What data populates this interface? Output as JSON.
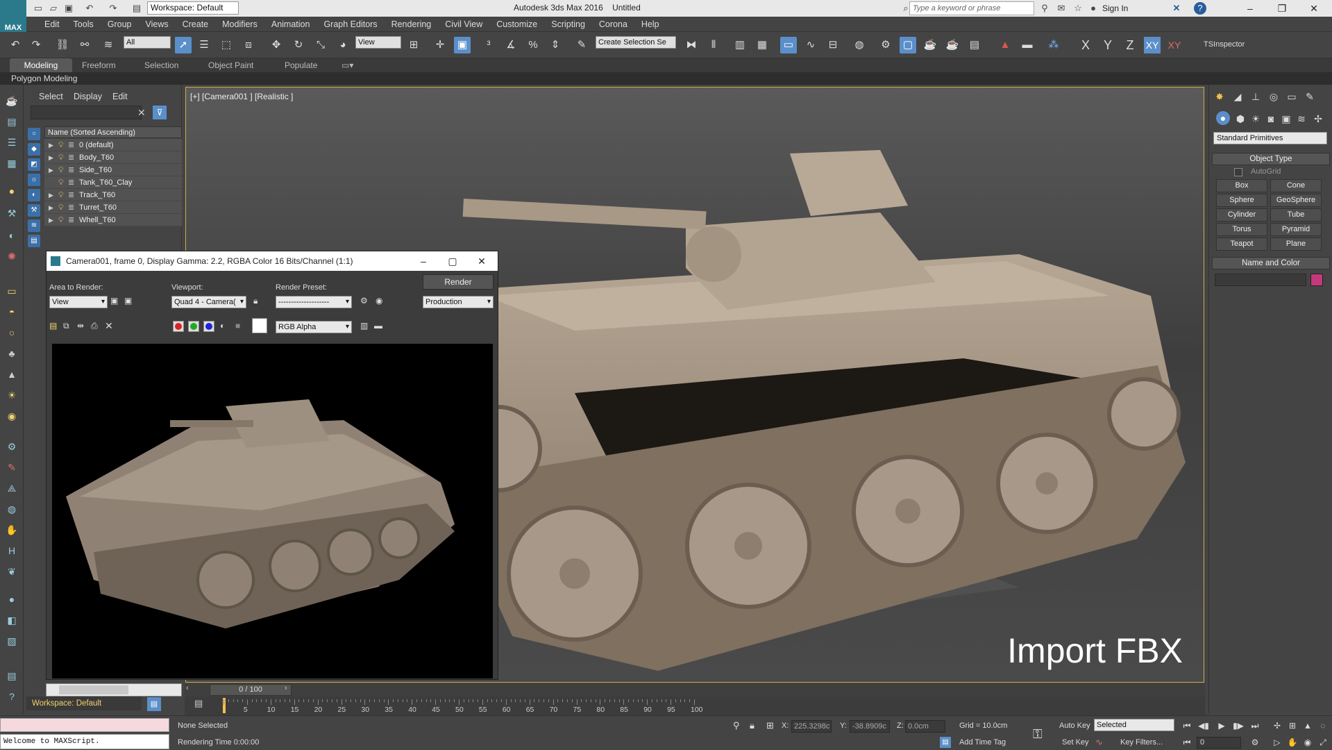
{
  "app": {
    "logo": "MAX",
    "workspace": "Workspace: Default",
    "title": "Autodesk 3ds Max 2016",
    "file": "Untitled",
    "search_placeholder": "Type a keyword or phrase",
    "sign_in": "Sign In"
  },
  "menu": [
    "Edit",
    "Tools",
    "Group",
    "Views",
    "Create",
    "Modifiers",
    "Animation",
    "Graph Editors",
    "Rendering",
    "Civil View",
    "Customize",
    "Scripting",
    "Corona",
    "Help"
  ],
  "toolbar": {
    "filter": "All",
    "ref_coord": "View",
    "named_sel": "Create Selection Se",
    "axes": [
      "X",
      "Y",
      "Z",
      "XY",
      "XY"
    ],
    "inspector": "TSInspector"
  },
  "ribbon": {
    "tabs": [
      "Modeling",
      "Freeform",
      "Selection",
      "Object Paint",
      "Populate"
    ],
    "active": "Modeling",
    "sub": "Polygon Modeling"
  },
  "explorer": {
    "menu": [
      "Select",
      "Display",
      "Edit"
    ],
    "header": "Name (Sorted Ascending)",
    "rows": [
      "0 (default)",
      "Body_T60",
      "Side_T60",
      "Tank_T60_Clay",
      "Track_T60",
      "Turret_T60",
      "Whell_T60"
    ]
  },
  "viewport": {
    "label": "[+] [Camera001 ] [Realistic ]",
    "overlay": "Import FBX"
  },
  "render_window": {
    "title": "Camera001, frame 0, Display Gamma: 2.2, RGBA Color 16 Bits/Channel (1:1)",
    "area_label": "Area to Render:",
    "area_value": "View",
    "viewport_label": "Viewport:",
    "viewport_value": "Quad 4 - Camera(",
    "preset_label": "Render Preset:",
    "preset_value": "--------------------",
    "render_button": "Render",
    "mode_value": "Production",
    "channel_value": "RGB Alpha"
  },
  "command_panel": {
    "dropdown": "Standard Primitives",
    "object_type": "Object Type",
    "autogrid": "AutoGrid",
    "buttons": [
      "Box",
      "Cone",
      "Sphere",
      "GeoSphere",
      "Cylinder",
      "Tube",
      "Torus",
      "Pyramid",
      "Teapot",
      "Plane"
    ],
    "name_color": "Name and Color",
    "color": "#c5387c"
  },
  "timeline": {
    "frame": "0 / 100",
    "ticks": [
      "5",
      "10",
      "15",
      "20",
      "25",
      "30",
      "35",
      "40",
      "45",
      "50",
      "55",
      "60",
      "65",
      "70",
      "75",
      "80",
      "85",
      "90",
      "95",
      "100"
    ],
    "workspace": "Workspace: Default"
  },
  "status": {
    "maxscript": "Welcome to MAXScript.",
    "selection": "None Selected",
    "render_time": "Rendering Time  0:00:00",
    "x_label": "X:",
    "x_value": "225.3298c",
    "y_label": "Y:",
    "y_value": "-38.8909c",
    "z_label": "Z:",
    "z_value": "0.0cm",
    "grid": "Grid = 10.0cm",
    "add_time_tag": "Add Time Tag",
    "auto_key": "Auto Key",
    "set_key": "Set Key",
    "key_mode": "Selected",
    "key_filters": "Key Filters...",
    "frame_field": "0"
  }
}
